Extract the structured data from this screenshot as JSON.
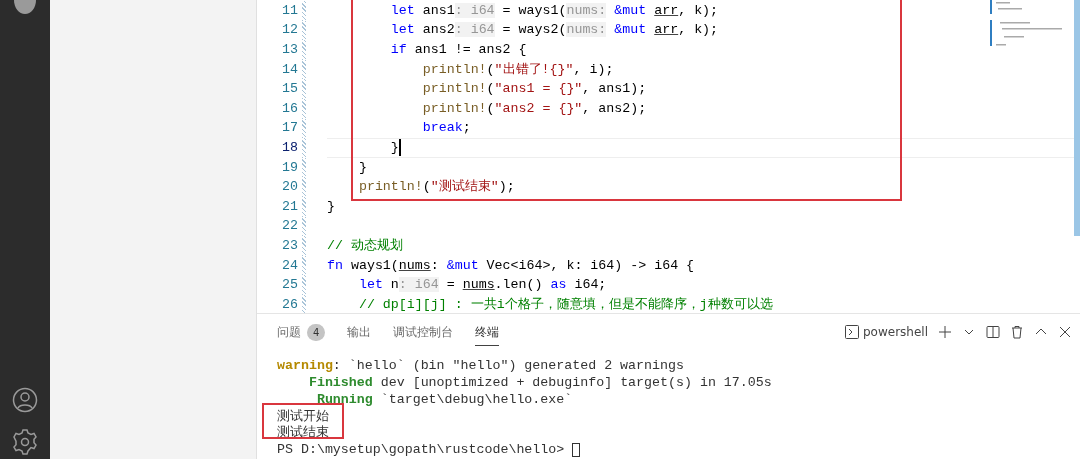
{
  "editor": {
    "lines": [
      {
        "number": "11",
        "current": false,
        "tokens": [
          {
            "text": "        let",
            "kind": "keyword"
          },
          {
            "text": " ans1",
            "kind": "plain"
          },
          {
            "text": ": i64",
            "kind": "hint"
          },
          {
            "text": " = ways1(",
            "kind": "plain"
          },
          {
            "text": "nums:",
            "kind": "hint"
          },
          {
            "text": " &mut ",
            "kind": "keyword"
          },
          {
            "text": "arr",
            "kind": "underlined"
          },
          {
            "text": ", k);",
            "kind": "plain"
          }
        ]
      },
      {
        "number": "12",
        "current": false,
        "tokens": [
          {
            "text": "        let",
            "kind": "keyword"
          },
          {
            "text": " ans2",
            "kind": "plain"
          },
          {
            "text": ": i64",
            "kind": "hint"
          },
          {
            "text": " = ways2(",
            "kind": "plain"
          },
          {
            "text": "nums:",
            "kind": "hint"
          },
          {
            "text": " &mut ",
            "kind": "keyword"
          },
          {
            "text": "arr",
            "kind": "underlined"
          },
          {
            "text": ", k);",
            "kind": "plain"
          }
        ]
      },
      {
        "number": "13",
        "current": false,
        "tokens": [
          {
            "text": "        if",
            "kind": "keyword"
          },
          {
            "text": " ans1 != ans2 {",
            "kind": "plain"
          }
        ]
      },
      {
        "number": "14",
        "current": false,
        "tokens": [
          {
            "text": "            println!",
            "kind": "macro"
          },
          {
            "text": "(",
            "kind": "plain"
          },
          {
            "text": "\"出错了!{}\"",
            "kind": "string"
          },
          {
            "text": ", i);",
            "kind": "plain"
          }
        ]
      },
      {
        "number": "15",
        "current": false,
        "tokens": [
          {
            "text": "            println!",
            "kind": "macro"
          },
          {
            "text": "(",
            "kind": "plain"
          },
          {
            "text": "\"ans1 = {}\"",
            "kind": "string"
          },
          {
            "text": ", ans1);",
            "kind": "plain"
          }
        ]
      },
      {
        "number": "16",
        "current": false,
        "tokens": [
          {
            "text": "            println!",
            "kind": "macro"
          },
          {
            "text": "(",
            "kind": "plain"
          },
          {
            "text": "\"ans2 = {}\"",
            "kind": "string"
          },
          {
            "text": ", ans2);",
            "kind": "plain"
          }
        ]
      },
      {
        "number": "17",
        "current": false,
        "tokens": [
          {
            "text": "            break",
            "kind": "keyword"
          },
          {
            "text": ";",
            "kind": "plain"
          }
        ]
      },
      {
        "number": "18",
        "current": true,
        "tokens": [
          {
            "text": "        }",
            "kind": "plain"
          }
        ]
      },
      {
        "number": "19",
        "current": false,
        "tokens": [
          {
            "text": "    }",
            "kind": "plain"
          }
        ]
      },
      {
        "number": "20",
        "current": false,
        "tokens": [
          {
            "text": "    println!",
            "kind": "macro"
          },
          {
            "text": "(",
            "kind": "plain"
          },
          {
            "text": "\"测试结束\"",
            "kind": "string"
          },
          {
            "text": ");",
            "kind": "plain"
          }
        ]
      },
      {
        "number": "21",
        "current": false,
        "tokens": [
          {
            "text": "}",
            "kind": "plain"
          }
        ]
      },
      {
        "number": "22",
        "current": false
      },
      {
        "number": "23",
        "current": false,
        "tokens": [
          {
            "text": "// 动态规划",
            "kind": "comment"
          }
        ]
      },
      {
        "number": "24",
        "current": false,
        "tokens": [
          {
            "text": "fn",
            "kind": "keyword"
          },
          {
            "text": " ways1(",
            "kind": "plain"
          },
          {
            "text": "nums",
            "kind": "underlined"
          },
          {
            "text": ": ",
            "kind": "plain"
          },
          {
            "text": "&mut",
            "kind": "keyword"
          },
          {
            "text": " Vec<i64>, k: i64) -> i64 {",
            "kind": "plain"
          }
        ]
      },
      {
        "number": "25",
        "current": false,
        "tokens": [
          {
            "text": "    let",
            "kind": "keyword"
          },
          {
            "text": " n",
            "kind": "plain"
          },
          {
            "text": ": i64",
            "kind": "hint"
          },
          {
            "text": " = ",
            "kind": "plain"
          },
          {
            "text": "nums",
            "kind": "underlined"
          },
          {
            "text": ".len() ",
            "kind": "plain"
          },
          {
            "text": "as",
            "kind": "keyword"
          },
          {
            "text": " i64;",
            "kind": "plain"
          }
        ]
      },
      {
        "number": "26",
        "current": false,
        "tokens": [
          {
            "text": "    // dp[i][j] : 一共i个格子，随意填，但是不能降序，j种数可以选",
            "kind": "comment"
          }
        ]
      }
    ]
  },
  "panel": {
    "tabs": [
      {
        "label": "问题",
        "badge": "4",
        "selected": false
      },
      {
        "label": "输出",
        "selected": false
      },
      {
        "label": "调试控制台",
        "selected": false
      },
      {
        "label": "终端",
        "selected": true
      }
    ],
    "terminal_name": "powershell",
    "terminal": [
      {
        "segments": [
          {
            "text": "warning",
            "kind": "warning"
          },
          {
            "text": ": `hello` (bin \"hello\") generated 2 warnings",
            "kind": "plain"
          }
        ]
      },
      {
        "segments": [
          {
            "text": "    Finished",
            "kind": "success"
          },
          {
            "text": " dev [unoptimized + debuginfo] target(s) in 17.05s",
            "kind": "plain"
          }
        ]
      },
      {
        "segments": [
          {
            "text": "     Running",
            "kind": "success"
          },
          {
            "text": " `target\\debug\\hello.exe`",
            "kind": "plain"
          }
        ]
      },
      {
        "segments": [
          {
            "text": "测试开始",
            "kind": "plain"
          }
        ]
      },
      {
        "segments": [
          {
            "text": "测试结束",
            "kind": "plain"
          }
        ]
      },
      {
        "segments": [
          {
            "text": "PS D:\\mysetup\\gopath\\rustcode\\hello> ",
            "kind": "plain"
          }
        ],
        "cursor": true
      }
    ]
  }
}
